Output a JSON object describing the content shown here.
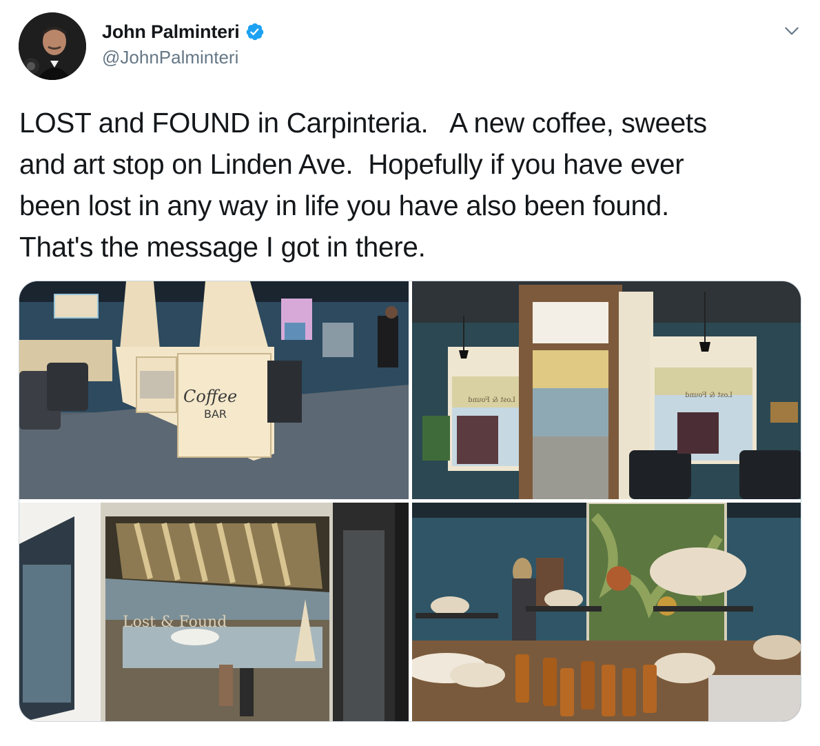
{
  "author": {
    "display_name": "John Palminteri",
    "handle": "@JohnPalminteri",
    "verified": true,
    "avatar_icon": "profile-photo",
    "verified_icon": "verified-badge-icon",
    "verified_color": "#1da1f2"
  },
  "menu": {
    "icon": "chevron-down-icon"
  },
  "tweet": {
    "lines": [
      "LOST and FOUND in Carpinteria.   A new coffee, sweets",
      "and art stop on Linden Ave.  Hopefully if you have ever",
      "been lost in any way in life you have also been found.",
      "That's the message I got in there."
    ]
  },
  "photos": [
    {
      "sign_text": "Coffee",
      "sign_sub": "BAR"
    },
    {
      "window_text_left": "Lost & Found",
      "window_text_right": "Lost & Found"
    },
    {
      "window_text": "Lost & Found"
    },
    {}
  ],
  "colors": {
    "text": "#14171a",
    "secondary": "#657786",
    "accent": "#1da1f2",
    "border": "#ccd6dd"
  }
}
